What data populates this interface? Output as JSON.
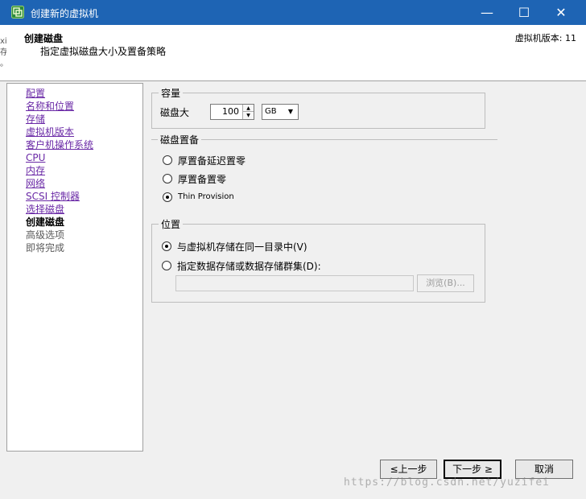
{
  "window": {
    "title": "创建新的虚拟机",
    "minimize": "—",
    "maximize": "☐",
    "close": "✕",
    "icon": "vm-wizard-icon"
  },
  "header": {
    "title": "创建磁盘",
    "subtitle": "指定虚拟磁盘大小及置备策略",
    "version": "虚拟机版本: 11",
    "edge_text": "xi\n存\n。"
  },
  "nav": {
    "items": [
      {
        "label": "配置",
        "state": "link"
      },
      {
        "label": "名称和位置",
        "state": "link"
      },
      {
        "label": "存储",
        "state": "link"
      },
      {
        "label": "虚拟机版本",
        "state": "link"
      },
      {
        "label": "客户机操作系统",
        "state": "link"
      },
      {
        "label": "CPU",
        "state": "link"
      },
      {
        "label": "内存",
        "state": "link"
      },
      {
        "label": "网络",
        "state": "link"
      },
      {
        "label": "SCSI 控制器",
        "state": "link"
      },
      {
        "label": "选择磁盘",
        "state": "link"
      },
      {
        "label": "创建磁盘",
        "state": "current"
      },
      {
        "label": "高级选项",
        "state": "disabled"
      },
      {
        "label": "即将完成",
        "state": "disabled"
      }
    ]
  },
  "capacity": {
    "group_label": "容量",
    "disk_size_label": "磁盘大",
    "disk_size_value": "100",
    "unit": "GB"
  },
  "provisioning": {
    "group_label": "磁盘置备",
    "options": [
      {
        "label": "厚置备延迟置零",
        "checked": false
      },
      {
        "label": "厚置备置零",
        "checked": false
      },
      {
        "label": "Thin Provision",
        "checked": true
      }
    ]
  },
  "location": {
    "group_label": "位置",
    "option_same_dir": "与虚拟机存储在同一目录中(V)",
    "option_specify": "指定数据存储或数据存储群集(D):",
    "path_value": "",
    "browse_label": "浏览(B)..."
  },
  "footer": {
    "back_label": "≤上一步",
    "next_label": "下一步 ≥",
    "cancel_label": "取消"
  },
  "watermark": "https://blog.csdn.net/yuzifei"
}
